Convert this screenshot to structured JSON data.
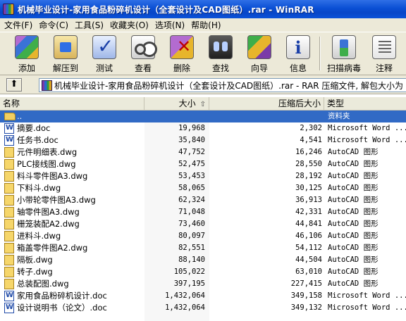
{
  "window": {
    "title": "机械毕业设计-家用食品粉碎机设计（全套设计及CAD图纸）.rar - WinRAR"
  },
  "menu": [
    {
      "label": "文件(F)"
    },
    {
      "label": "命令(C)"
    },
    {
      "label": "工具(S)"
    },
    {
      "label": "收藏夹(O)"
    },
    {
      "label": "选项(N)"
    },
    {
      "label": "帮助(H)"
    }
  ],
  "toolbar": [
    {
      "label": "添加",
      "icon": "add-archive-icon"
    },
    {
      "label": "解压到",
      "icon": "extract-to-icon"
    },
    {
      "label": "测试",
      "icon": "test-icon"
    },
    {
      "label": "查看",
      "icon": "view-icon"
    },
    {
      "label": "删除",
      "icon": "delete-icon"
    },
    {
      "label": "查找",
      "icon": "find-icon"
    },
    {
      "label": "向导",
      "icon": "wizard-icon"
    },
    {
      "label": "信息",
      "icon": "info-icon"
    },
    {
      "label": "扫描病毒",
      "icon": "virus-scan-icon"
    },
    {
      "label": "注释",
      "icon": "comment-icon"
    }
  ],
  "address": {
    "path": "机械毕业设计-家用食品粉碎机设计（全套设计及CAD图纸）.rar - RAR 压缩文件, 解包大小为"
  },
  "columns": {
    "name": "名称",
    "size": "大小",
    "packed": "压缩后大小",
    "type": "类型"
  },
  "files": [
    {
      "name": "..",
      "size": "",
      "packed": "",
      "type": "资料夹",
      "kind": "folder"
    },
    {
      "name": "摘要.doc",
      "size": "19,968",
      "packed": "2,302",
      "type": "Microsoft Word ...",
      "kind": "doc"
    },
    {
      "name": "任务书.doc",
      "size": "35,840",
      "packed": "4,541",
      "type": "Microsoft Word ...",
      "kind": "doc"
    },
    {
      "name": "元件明细表.dwg",
      "size": "47,752",
      "packed": "16,246",
      "type": "AutoCAD 图形",
      "kind": "dwg"
    },
    {
      "name": "PLC接线图.dwg",
      "size": "52,475",
      "packed": "28,550",
      "type": "AutoCAD 图形",
      "kind": "dwg"
    },
    {
      "name": "料斗零件图A3.dwg",
      "size": "53,453",
      "packed": "28,192",
      "type": "AutoCAD 图形",
      "kind": "dwg"
    },
    {
      "name": "下料斗.dwg",
      "size": "58,065",
      "packed": "30,125",
      "type": "AutoCAD 图形",
      "kind": "dwg"
    },
    {
      "name": "小带轮零件图A3.dwg",
      "size": "62,324",
      "packed": "36,913",
      "type": "AutoCAD 图形",
      "kind": "dwg"
    },
    {
      "name": "轴零件图A3.dwg",
      "size": "71,048",
      "packed": "42,331",
      "type": "AutoCAD 图形",
      "kind": "dwg"
    },
    {
      "name": "栅笼装配A2.dwg",
      "size": "73,460",
      "packed": "44,841",
      "type": "AutoCAD 图形",
      "kind": "dwg"
    },
    {
      "name": "进料斗.dwg",
      "size": "80,097",
      "packed": "46,106",
      "type": "AutoCAD 图形",
      "kind": "dwg"
    },
    {
      "name": "箱盖零件图A2.dwg",
      "size": "82,551",
      "packed": "54,112",
      "type": "AutoCAD 图形",
      "kind": "dwg"
    },
    {
      "name": "隔板.dwg",
      "size": "88,140",
      "packed": "44,504",
      "type": "AutoCAD 图形",
      "kind": "dwg"
    },
    {
      "name": "转子.dwg",
      "size": "105,022",
      "packed": "63,010",
      "type": "AutoCAD 图形",
      "kind": "dwg"
    },
    {
      "name": "总装配图.dwg",
      "size": "397,195",
      "packed": "227,415",
      "type": "AutoCAD 图形",
      "kind": "dwg"
    },
    {
      "name": "家用食品粉碎机设计.doc",
      "size": "1,432,064",
      "packed": "349,158",
      "type": "Microsoft Word ...",
      "kind": "doc"
    },
    {
      "name": "设计说明书（论文）.doc",
      "size": "1,432,064",
      "packed": "349,132",
      "type": "Microsoft Word ...",
      "kind": "doc"
    }
  ]
}
